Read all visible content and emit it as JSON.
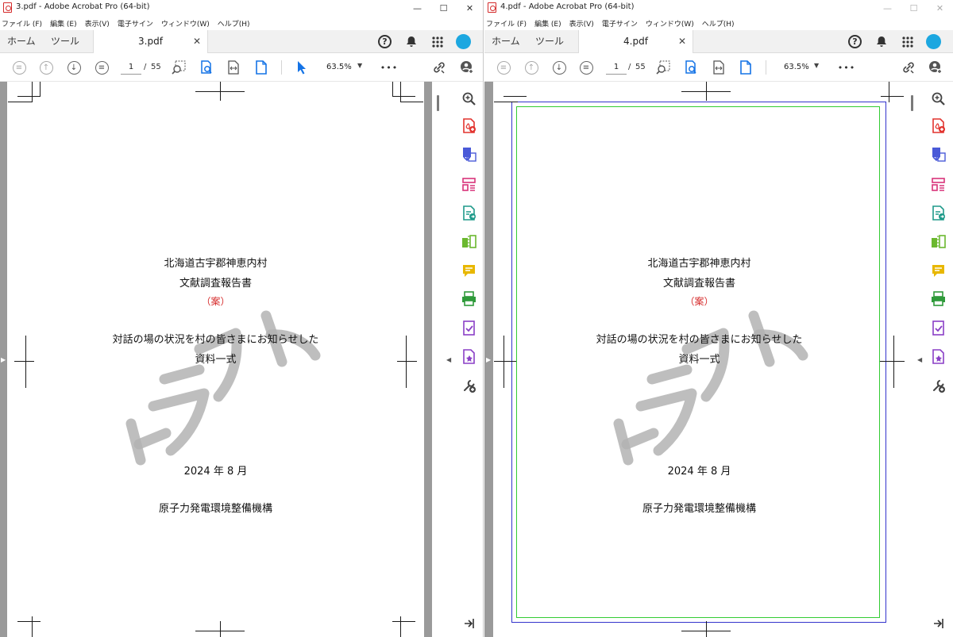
{
  "windows": [
    {
      "title": "3.pdf - Adobe Acrobat Pro (64-bit)",
      "tab_label": "3.pdf",
      "draw_frame": false
    },
    {
      "title": "4.pdf - Adobe Acrobat Pro (64-bit)",
      "tab_label": "4.pdf",
      "draw_frame": true
    }
  ],
  "window_controls": {
    "minimize": "—",
    "maximize": "☐",
    "close": "✕"
  },
  "menu": [
    "ファイル (F)",
    "編集 (E)",
    "表示(V)",
    "電子サイン",
    "ウィンドウ(W)",
    "ヘルプ(H)"
  ],
  "tabs": {
    "home": "ホーム",
    "tools": "ツール",
    "close": "✕"
  },
  "tabbar_icons": {
    "help": "?",
    "bell": "🔔",
    "apps": "⋮⋮⋮"
  },
  "toolbar": {
    "page_current": "1",
    "page_separator": "/",
    "page_total": "55",
    "zoom": "63.5%",
    "zoom_caret": "▼",
    "more": "•••"
  },
  "document": {
    "title_line1": "北海道古宇郡神恵内村",
    "title_line2": "文献調査報告書",
    "draft_mark": "（案）",
    "subtitle_line1": "対話の場の状況を村の皆さまにお知らせした",
    "subtitle_line2": "資料一式",
    "date": "2024 年 8 月",
    "organization": "原子力発電環境整備機構"
  },
  "right_panel_icons": [
    {
      "name": "search-zoom-icon",
      "color": "#444444"
    },
    {
      "name": "create-pdf-icon",
      "color": "#e2342f"
    },
    {
      "name": "export-pdf-icon",
      "color": "#4a5ad8"
    },
    {
      "name": "organize-pages-icon",
      "color": "#d8337a"
    },
    {
      "name": "edit-pdf-icon",
      "color": "#1f9a8a"
    },
    {
      "name": "compare-files-icon",
      "color": "#6bb82f"
    },
    {
      "name": "comment-icon",
      "color": "#e8b700"
    },
    {
      "name": "scan-ocr-icon",
      "color": "#2f9a3a"
    },
    {
      "name": "fill-sign-icon",
      "color": "#8a3fc6"
    },
    {
      "name": "request-signature-icon",
      "color": "#8a3fc6"
    },
    {
      "name": "more-tools-icon",
      "color": "#444444"
    }
  ]
}
